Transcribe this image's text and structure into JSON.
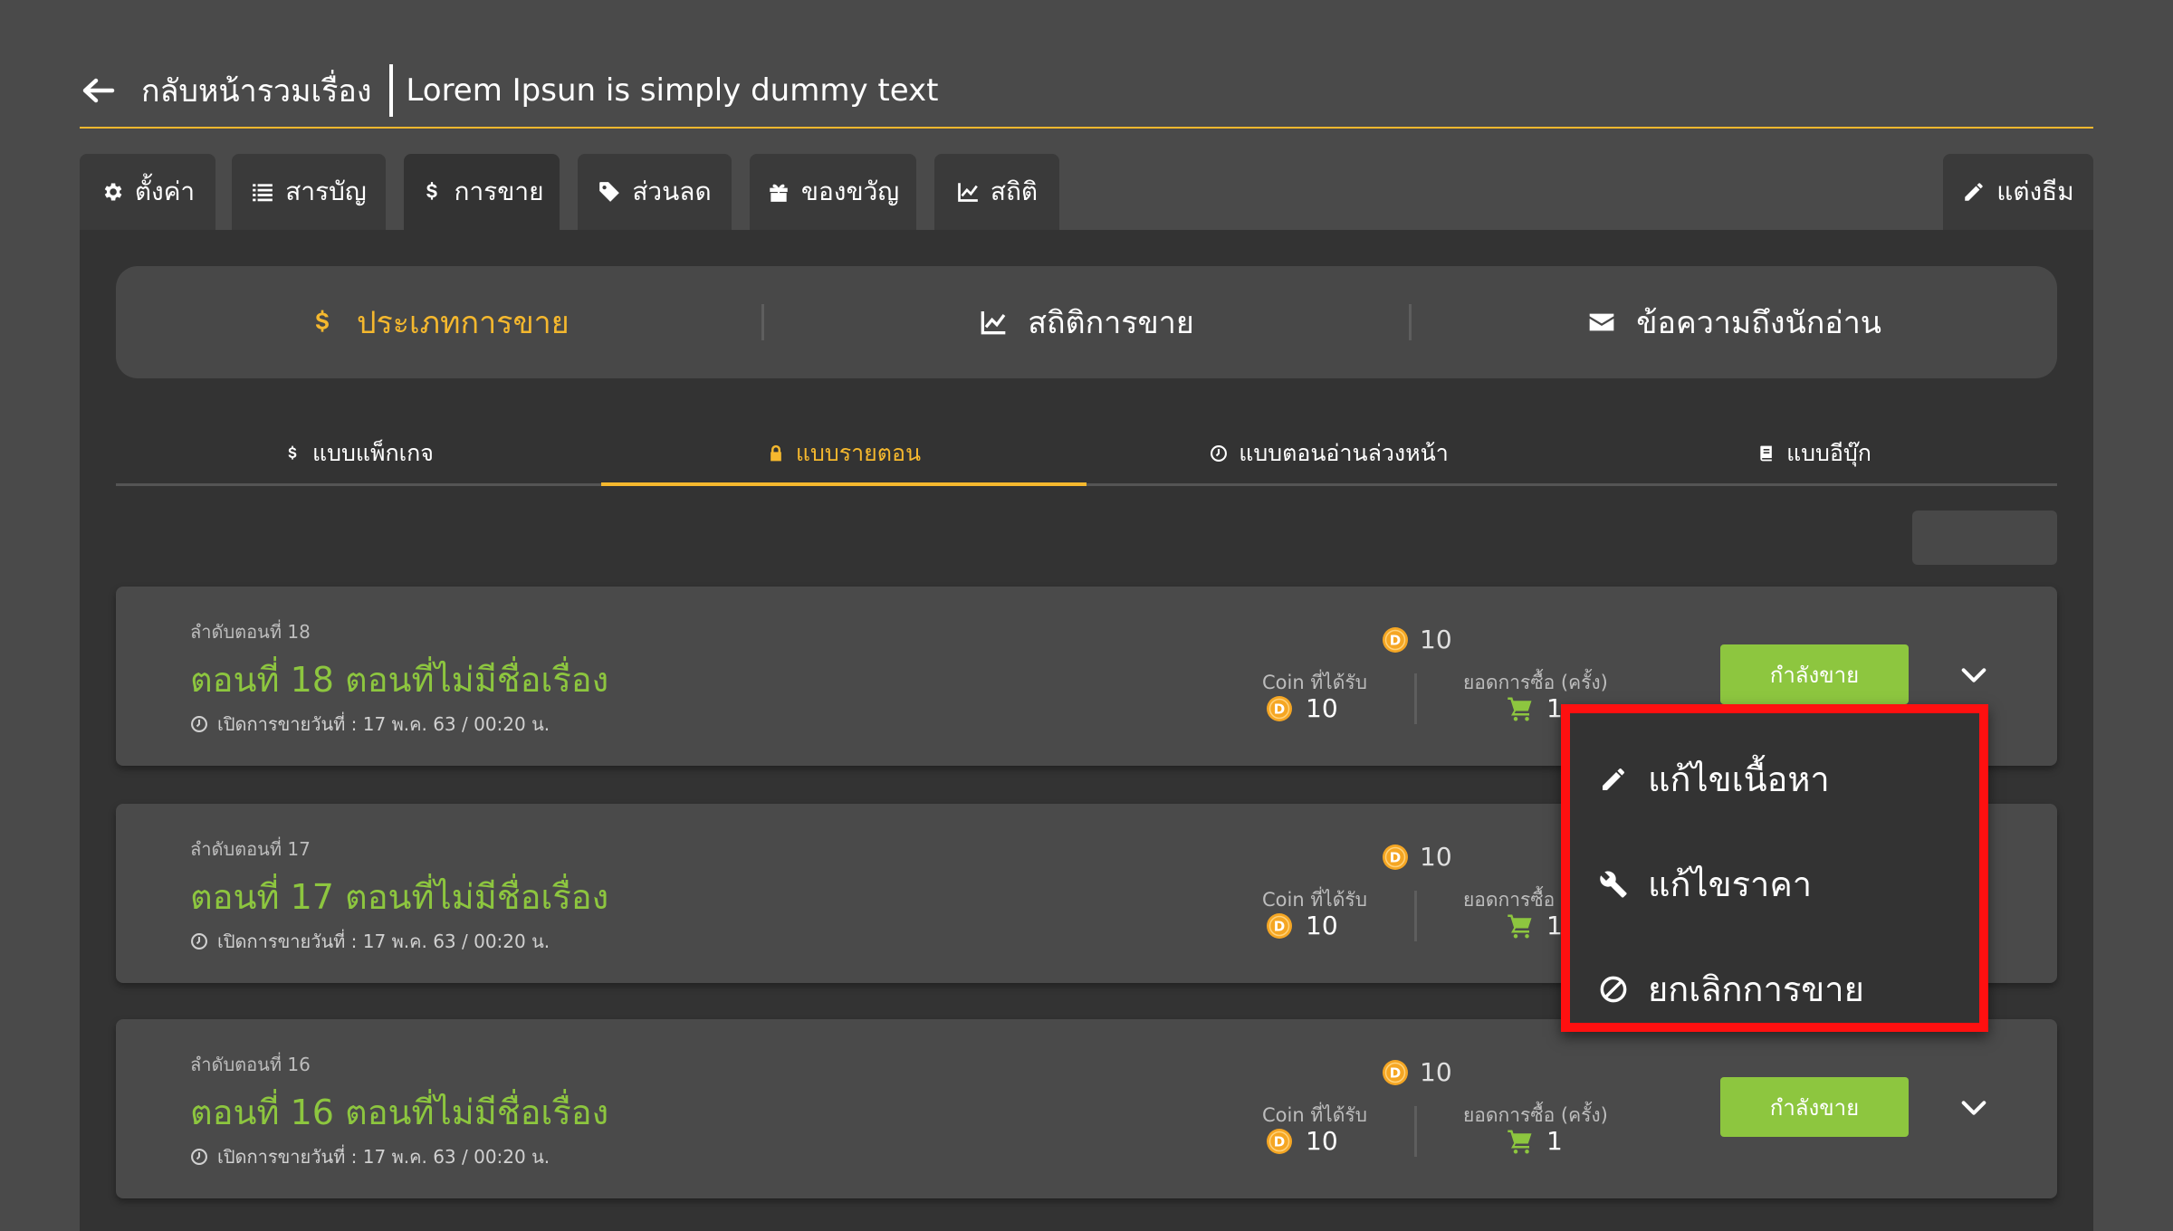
{
  "header": {
    "back_label": "กลับหน้ารวมเรื่อง",
    "story_title": "Lorem Ipsun is simply dummy text"
  },
  "top_tabs": [
    {
      "label": "ตั้งค่า",
      "icon": "gear-icon"
    },
    {
      "label": "สารบัญ",
      "icon": "list-icon"
    },
    {
      "label": "การขาย",
      "icon": "dollar-icon",
      "active": true
    },
    {
      "label": "ส่วนลด",
      "icon": "tag-icon"
    },
    {
      "label": "ของขวัญ",
      "icon": "gift-icon"
    },
    {
      "label": "สถิติ",
      "icon": "chart-icon"
    }
  ],
  "theme_tab": {
    "label": "แต่งธีม",
    "icon": "pencil-icon"
  },
  "segments": [
    {
      "label": "ประเภทการขาย",
      "icon": "dollar-icon",
      "active": true
    },
    {
      "label": "สถิติการขาย",
      "icon": "chart-icon"
    },
    {
      "label": "ข้อความถึงนักอ่าน",
      "icon": "envelope-icon"
    }
  ],
  "subtabs": [
    {
      "label": "แบบแพ็กเกจ",
      "icon": "dollar-icon"
    },
    {
      "label": "แบบรายตอน",
      "icon": "lock-icon",
      "active": true
    },
    {
      "label": "แบบตอนอ่านล่วงหน้า",
      "icon": "clock-icon"
    },
    {
      "label": "แบบอีบุ๊ก",
      "icon": "book-icon"
    }
  ],
  "episodes": [
    {
      "order": "ลำดับตอนที่ 18",
      "title": "ตอนที่ 18 ตอนที่ไม่มีชื่อเรื่อง",
      "date": "เปิดการขายวันที่ :  17 พ.ค. 63 / 00:20 น.",
      "price": "10",
      "coin_label": "Coin ที่ได้รับ",
      "coin_value": "10",
      "purchase_label": "ยอดการซื้อ (ครั้ง)",
      "purchase_value": "1",
      "status": "กำลังขาย"
    },
    {
      "order": "ลำดับตอนที่ 17",
      "title": "ตอนที่ 17 ตอนที่ไม่มีชื่อเรื่อง",
      "date": "เปิดการขายวันที่ :  17 พ.ค. 63 / 00:20 น.",
      "price": "10",
      "coin_label": "Coin ที่ได้รับ",
      "coin_value": "10",
      "purchase_label": "ยอดการซื้อ (",
      "purchase_value": "1",
      "status": ""
    },
    {
      "order": "ลำดับตอนที่ 16",
      "title": "ตอนที่ 16 ตอนที่ไม่มีชื่อเรื่อง",
      "date": "เปิดการขายวันที่ :  17 พ.ค. 63 / 00:20 น.",
      "price": "10",
      "coin_label": "Coin ที่ได้รับ",
      "coin_value": "10",
      "purchase_label": "ยอดการซื้อ (ครั้ง)",
      "purchase_value": "1",
      "status": "กำลังขาย"
    }
  ],
  "dropdown": {
    "items": [
      {
        "label": "แก้ไขเนื้อหา",
        "icon": "pencil-icon"
      },
      {
        "label": "แก้ไขราคา",
        "icon": "wrench-icon"
      },
      {
        "label": "ยกเลิกการขาย",
        "icon": "ban-icon"
      }
    ]
  },
  "colors": {
    "accent": "#f5b82e",
    "success": "#8dc63f",
    "highlight": "#ff1010",
    "background": "#4a4a4a",
    "panel": "#333333"
  }
}
